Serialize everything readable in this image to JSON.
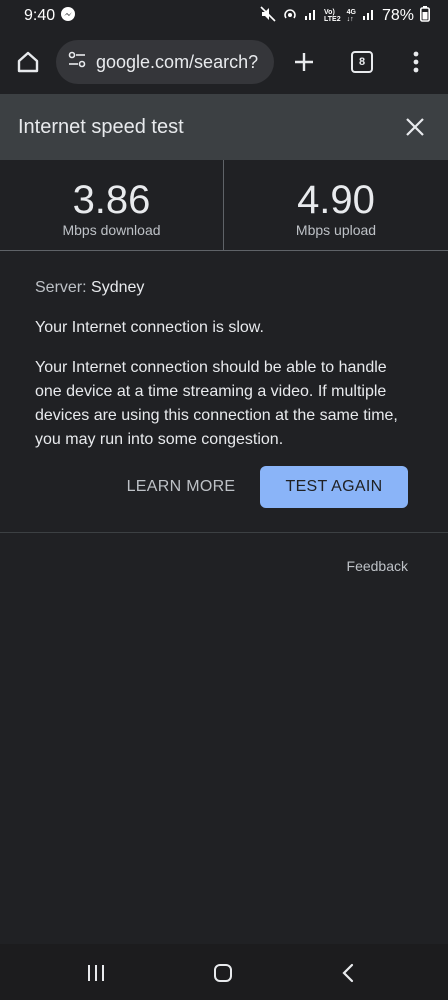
{
  "status_bar": {
    "time": "9:40",
    "battery": "78%",
    "network_top": "Vo)",
    "network_bottom": "LTE2",
    "net_4g": "4G",
    "icons": [
      "messenger-icon",
      "mute-icon",
      "hotspot-icon",
      "signal-icon",
      "battery-icon"
    ]
  },
  "browser": {
    "url": "google.com/search?",
    "tab_count": "8",
    "icons": [
      "home-icon",
      "site-info-icon",
      "plus-icon",
      "tabs-icon",
      "menu-icon"
    ]
  },
  "widget": {
    "title": "Internet speed test",
    "download": {
      "value": "3.86",
      "label": "Mbps download"
    },
    "upload": {
      "value": "4.90",
      "label": "Mbps upload"
    },
    "server_key": "Server:",
    "server_value": "Sydney",
    "slow_message": "Your Internet connection is slow.",
    "description": "Your Internet connection should be able to handle one device at a time streaming a video. If multiple devices are using this connection at the same time, you may run into some congestion.",
    "learn_more": "LEARN MORE",
    "test_again": "TEST AGAIN",
    "feedback": "Feedback"
  },
  "colors": {
    "background": "#202124",
    "header": "#3c4043",
    "accent": "#8ab4f8"
  }
}
